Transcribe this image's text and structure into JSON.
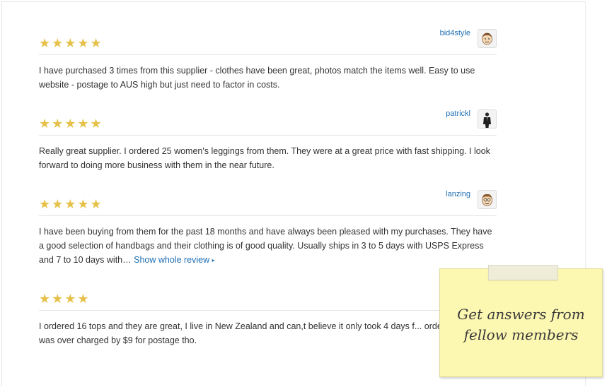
{
  "reviews": [
    {
      "stars": "★★★★★",
      "rating": 5,
      "username": "bid4style",
      "text": "I have purchased 3 times from this supplier - clothes have been great, photos match the items well. Easy to use website - postage to AUS high but just need to factor in costs."
    },
    {
      "stars": "★★★★★",
      "rating": 5,
      "username": "patrickl",
      "text": "Really great supplier. I ordered 25 women's leggings from them. They were at a great price with fast shipping. I look forward to doing more business with them in the near future."
    },
    {
      "stars": "★★★★★",
      "rating": 5,
      "username": "lanzing",
      "text": "I have been buying from them for the past 18 months and have always been pleased with my purchases. They have a good selection of handbags and their clothing is of good quality. Usually ships in 3 to 5 days with USPS Express and 7 to 10 days with…",
      "more_label": "Show whole review",
      "more_icon": "▸"
    },
    {
      "stars": "★★★★",
      "rating": 4,
      "username": "",
      "text": "I ordered 16 tops and they are great, I live in New Zealand and can,t believe it only took 4 days f... ordered to arrive. I was over charged by $9 for postage tho."
    }
  ],
  "sticky_note": {
    "text": "Get answers from\nfellow members"
  },
  "colors": {
    "star": "#e6c14a",
    "link": "#1f6fb3",
    "note_bg": "#fdf8b1"
  }
}
